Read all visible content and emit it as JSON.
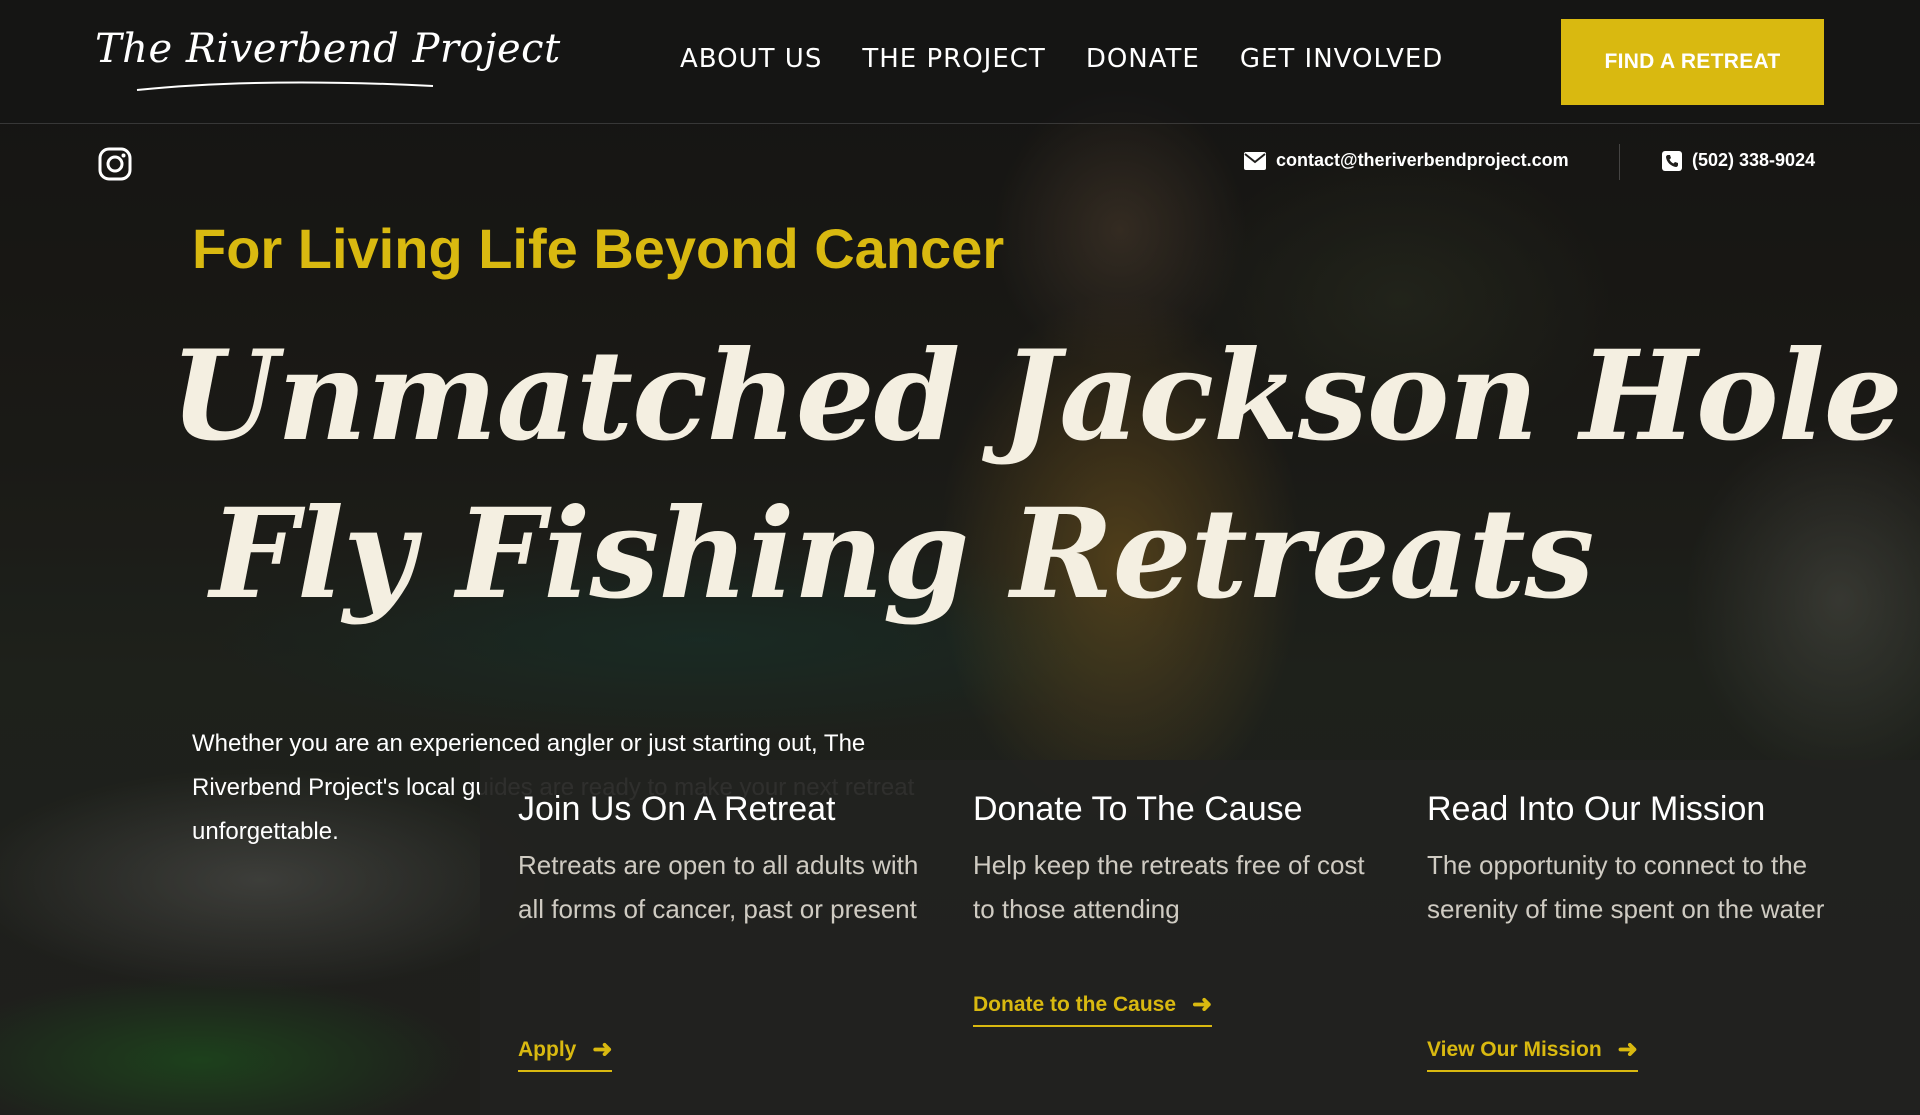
{
  "header": {
    "logo_text": "The Riverbend Project",
    "nav": [
      "ABOUT US",
      "THE PROJECT",
      "DONATE",
      "GET INVOLVED"
    ],
    "cta_label": "FIND A RETREAT"
  },
  "contact": {
    "email": "contact@theriverbendproject.com",
    "phone": "(502) 338-9024"
  },
  "hero": {
    "tagline": "For Living Life Beyond Cancer",
    "headline_line1": "Unmatched Jackson Hole",
    "headline_line2": "Fly Fishing Retreats",
    "description": "Whether you are an experienced angler or just starting out, The Riverbend Project's local guides are ready to make your next retreat unforgettable."
  },
  "cards": [
    {
      "title": "Join Us On A Retreat",
      "text": "Retreats are open to all adults with all forms of cancer, past or present",
      "link": "Apply"
    },
    {
      "title": "Donate To The Cause",
      "text": "Help keep the retreats free of cost to those attending",
      "link": "Donate to the Cause"
    },
    {
      "title": "Read Into Our Mission",
      "text": "The opportunity to connect to the serenity of time spent on the water",
      "link": "View Our Mission"
    }
  ],
  "colors": {
    "accent": "#d9b910",
    "panel": "#222220",
    "headline": "#f4efe1"
  },
  "icons": {
    "social": "instagram-icon",
    "email": "envelope-icon",
    "phone": "phone-icon",
    "link": "arrow-right-icon"
  }
}
